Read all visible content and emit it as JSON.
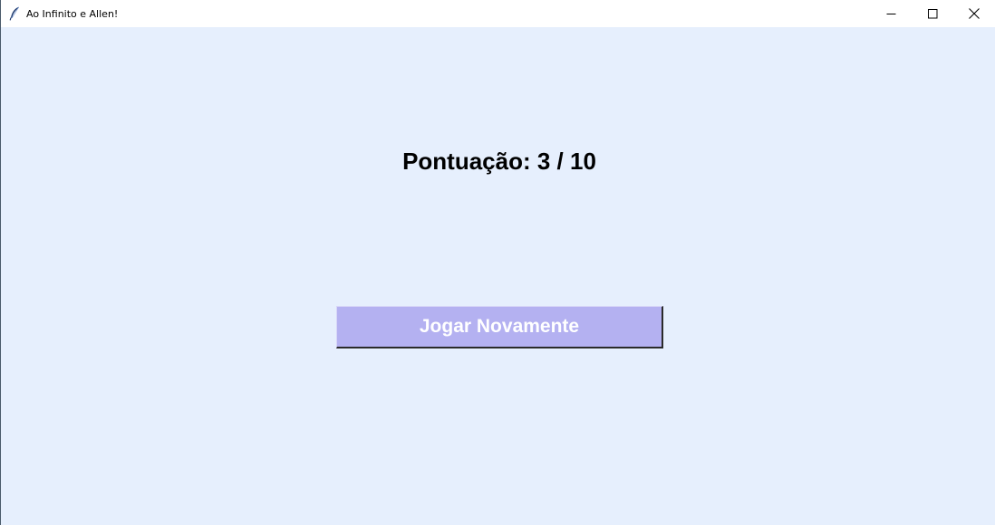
{
  "window": {
    "title": "Ao Infinito e Allen!",
    "icon": "feather-icon",
    "controls": [
      "minimize-icon",
      "maximize-icon",
      "close-icon"
    ]
  },
  "main": {
    "score_text": "Pontuação: 3 / 10",
    "replay_button_label": "Jogar Novamente"
  },
  "colors": {
    "background": "#e6effd",
    "button": "#b4b1f1",
    "button_text": "#ffffff",
    "score_text": "#000000"
  }
}
